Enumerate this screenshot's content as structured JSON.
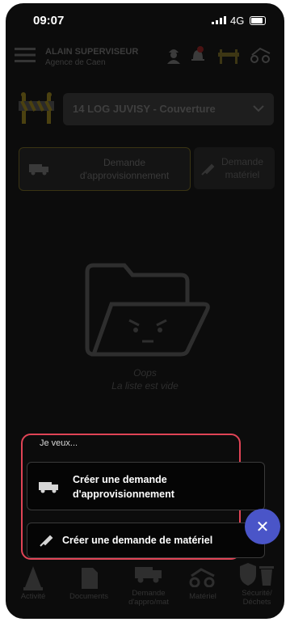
{
  "status_bar": {
    "time": "09:07",
    "network": "4G"
  },
  "header": {
    "user_name": "ALAIN SUPERVISEUR",
    "agency": "Agence de Caen"
  },
  "site_select": {
    "value": "14 LOG JUVISY - Couverture"
  },
  "tabs": [
    {
      "line1": "Demande",
      "line2": "d'approvisionnement"
    },
    {
      "line1": "Demande",
      "line2": "matériel"
    }
  ],
  "empty_state": {
    "title": "Oops",
    "message": "La liste est vide"
  },
  "action_menu": {
    "heading": "Je veux...",
    "option1_line1": "Créer une demande",
    "option1_line2": "d'approvisionnement",
    "option2": "Créer une demande de matériel"
  },
  "bottom_nav": [
    {
      "label": "Activité"
    },
    {
      "label": "Documents"
    },
    {
      "label_line1": "Demande",
      "label_line2": "d'appro/mat"
    },
    {
      "label": "Matériel"
    },
    {
      "label_line1": "Sécurité/",
      "label_line2": "Déchets"
    }
  ],
  "colors": {
    "accent": "#f2c21b",
    "highlight_box": "#e04456",
    "fab": "#4a55c8"
  }
}
